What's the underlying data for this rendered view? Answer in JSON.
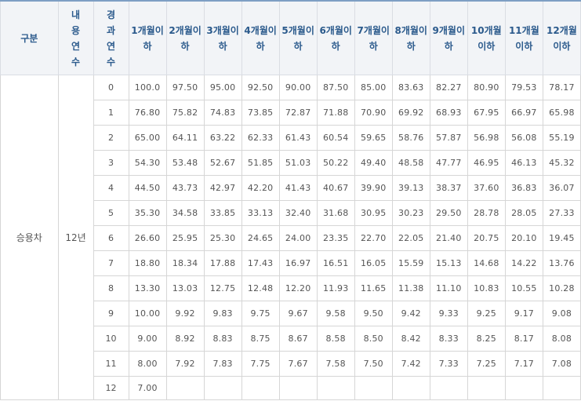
{
  "header": {
    "category": "구분",
    "useful_life": "내용연수",
    "elapsed_years": "경과연수",
    "months": [
      "1개월이하",
      "2개월이하",
      "3개월이하",
      "4개월이하",
      "5개월이하",
      "6개월이하",
      "7개월이하",
      "8개월이하",
      "9개월이하",
      "10개월이하",
      "11개월이하",
      "12개월이하"
    ]
  },
  "category": "승용차",
  "useful_life": "12년",
  "rows": [
    {
      "year": "0",
      "values": [
        "100.0",
        "97.50",
        "95.00",
        "92.50",
        "90.00",
        "87.50",
        "85.00",
        "83.63",
        "82.27",
        "80.90",
        "79.53",
        "78.17"
      ]
    },
    {
      "year": "1",
      "values": [
        "76.80",
        "75.82",
        "74.83",
        "73.85",
        "72.87",
        "71.88",
        "70.90",
        "69.92",
        "68.93",
        "67.95",
        "66.97",
        "65.98"
      ]
    },
    {
      "year": "2",
      "values": [
        "65.00",
        "64.11",
        "63.22",
        "62.33",
        "61.43",
        "60.54",
        "59.65",
        "58.76",
        "57.87",
        "56.98",
        "56.08",
        "55.19"
      ]
    },
    {
      "year": "3",
      "values": [
        "54.30",
        "53.48",
        "52.67",
        "51.85",
        "51.03",
        "50.22",
        "49.40",
        "48.58",
        "47.77",
        "46.95",
        "46.13",
        "45.32"
      ]
    },
    {
      "year": "4",
      "values": [
        "44.50",
        "43.73",
        "42.97",
        "42.20",
        "41.43",
        "40.67",
        "39.90",
        "39.13",
        "38.37",
        "37.60",
        "36.83",
        "36.07"
      ]
    },
    {
      "year": "5",
      "values": [
        "35.30",
        "34.58",
        "33.85",
        "33.13",
        "32.40",
        "31.68",
        "30.95",
        "30.23",
        "29.50",
        "28.78",
        "28.05",
        "27.33"
      ]
    },
    {
      "year": "6",
      "values": [
        "26.60",
        "25.95",
        "25.30",
        "24.65",
        "24.00",
        "23.35",
        "22.70",
        "22.05",
        "21.40",
        "20.75",
        "20.10",
        "19.45"
      ]
    },
    {
      "year": "7",
      "values": [
        "18.80",
        "18.34",
        "17.88",
        "17.43",
        "16.97",
        "16.51",
        "16.05",
        "15.59",
        "15.13",
        "14.68",
        "14.22",
        "13.76"
      ]
    },
    {
      "year": "8",
      "values": [
        "13.30",
        "13.03",
        "12.75",
        "12.48",
        "12.20",
        "11.93",
        "11.65",
        "11.38",
        "11.10",
        "10.83",
        "10.55",
        "10.28"
      ]
    },
    {
      "year": "9",
      "values": [
        "10.00",
        "9.92",
        "9.83",
        "9.75",
        "9.67",
        "9.58",
        "9.50",
        "9.42",
        "9.33",
        "9.25",
        "9.17",
        "9.08"
      ]
    },
    {
      "year": "10",
      "values": [
        "9.00",
        "8.92",
        "8.83",
        "8.75",
        "8.67",
        "8.58",
        "8.50",
        "8.42",
        "8.33",
        "8.25",
        "8.17",
        "8.08"
      ]
    },
    {
      "year": "11",
      "values": [
        "8.00",
        "7.92",
        "7.83",
        "7.75",
        "7.67",
        "7.58",
        "7.50",
        "7.42",
        "7.33",
        "7.25",
        "7.17",
        "7.08"
      ]
    },
    {
      "year": "12",
      "values": [
        "7.00",
        "",
        "",
        "",
        "",
        "",
        "",
        "",
        "",
        "",
        "",
        ""
      ]
    }
  ]
}
